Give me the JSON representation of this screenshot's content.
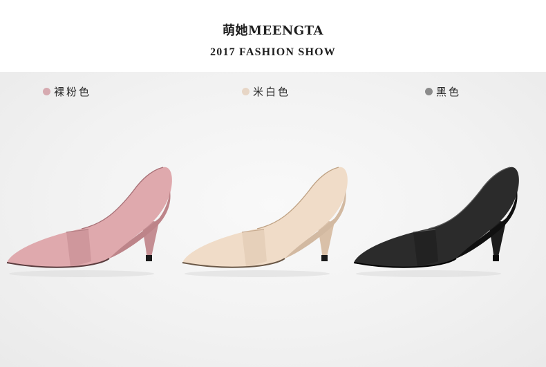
{
  "header": {
    "brand": "萌她MEENGTA",
    "subtitle": "2017 FASHION SHOW"
  },
  "colors": [
    {
      "label": "裸粉色",
      "dot": "#d6aab0",
      "shoe": "#dfa9ad",
      "shade": "#bd8489",
      "lining": "#f4ddd9"
    },
    {
      "label": "米白色",
      "dot": "#e7d6c6",
      "shoe": "#f0dcc8",
      "shade": "#d2b9a1",
      "lining": "#f8ece0"
    },
    {
      "label": "黑色",
      "dot": "#8b8b8b",
      "shoe": "#2b2b2b",
      "shade": "#101010",
      "lining": "#4a4a4a"
    }
  ]
}
